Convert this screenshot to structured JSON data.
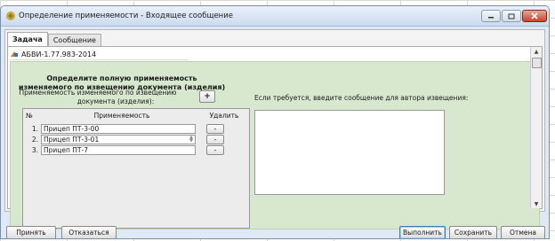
{
  "window": {
    "title": "Определение применяемости - Входящее сообщение"
  },
  "tabs": [
    {
      "label": "Задача",
      "active": true
    },
    {
      "label": "Сообщение",
      "active": false
    }
  ],
  "document": {
    "code": "АБВИ-1.77.983-2014"
  },
  "panel": {
    "title_line1": "Определите полную применяемость",
    "title_line2": "изменяемого по извещению документа (изделия)",
    "applicability_label_line1": "Применяемость изменяемого по извещению",
    "applicability_label_line2": "документа (изделия):",
    "add_button": "+",
    "hint": "Если требуется, введите сообщение для автора извещения:"
  },
  "table": {
    "headers": {
      "num": "№",
      "applicability": "Применяемость",
      "delete": "Удалить"
    },
    "rows": [
      {
        "num": "1.",
        "value": "Прицеп ПТ-3-00",
        "delete": "-"
      },
      {
        "num": "2.",
        "value": "Прицеп ПТ-3-01",
        "delete": "-"
      },
      {
        "num": "3.",
        "value": "Прицеп ПТ-7",
        "delete": "-"
      }
    ]
  },
  "buttons": {
    "accept": "Принять",
    "decline": "Отказаться",
    "execute": "Выполнить",
    "save": "Сохранить",
    "cancel": "Отмена"
  },
  "icons": {
    "app": "app-icon",
    "doc": "document-icon"
  },
  "colors": {
    "panel_bg": "#d8e8cf",
    "titlebar": "#cbdaee",
    "close": "#c9452b"
  }
}
